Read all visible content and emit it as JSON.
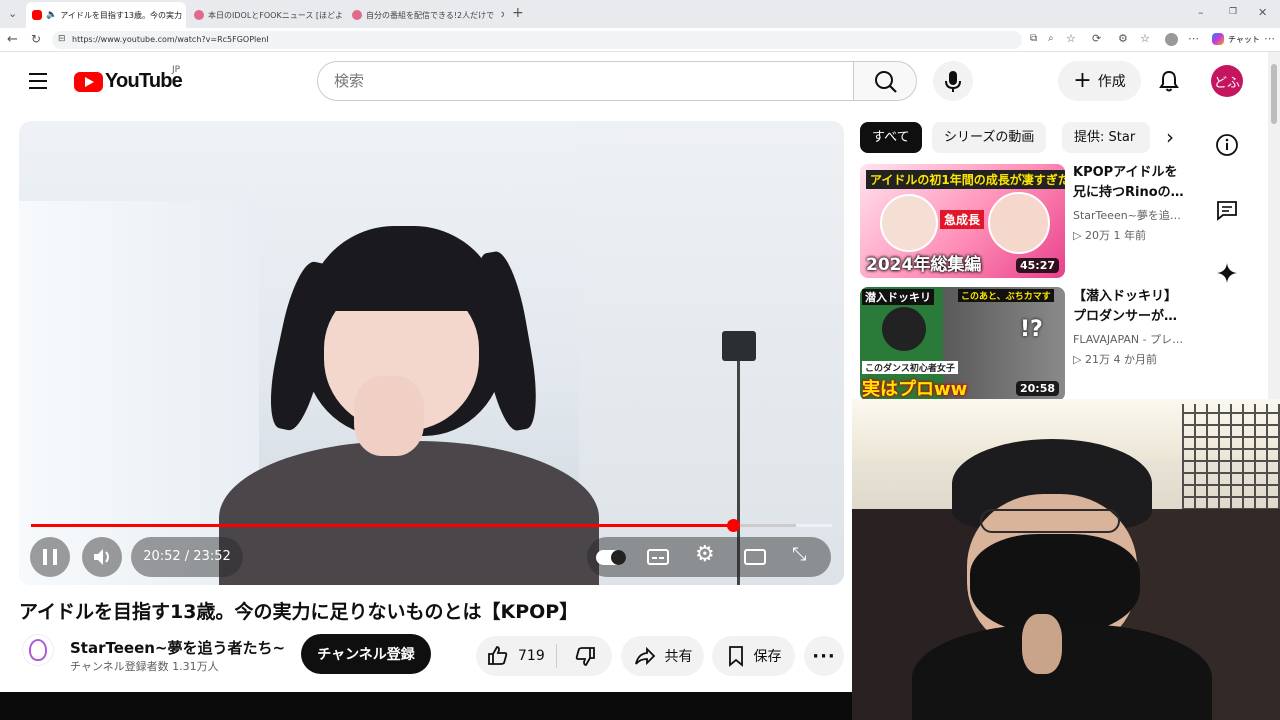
{
  "browser": {
    "tabs": [
      {
        "label": "アイドルを目指す13歳。今の実力",
        "favicon_color": "#ff0000"
      },
      {
        "label": "本日のIDOLとFOOKニュース [ほどよい",
        "favicon_color": "#e06a8a"
      },
      {
        "label": "自分の番組を配信できる!2人だけで",
        "favicon_color": "#e06a8a"
      }
    ],
    "url": "https://www.youtube.com/watch?v=Rc5FGOPlenI",
    "chat_label": "チャット"
  },
  "header": {
    "logo_text": "YouTube",
    "region": "JP",
    "search_placeholder": "検索",
    "create_label": "作成",
    "avatar_text": "どふ"
  },
  "player": {
    "progress": 0.8765,
    "buffered": 0.955,
    "time": "20:52 / 23:52"
  },
  "video": {
    "title": "アイドルを目指す13歳。今の実力に足りないものとは【KPOP】",
    "channel_name": "StarTeeen~夢を追う者たち~",
    "subscribers": "チャンネル登録者数 1.31万人",
    "subscribe_label": "チャンネル登録",
    "likes": "719",
    "share_label": "共有",
    "save_label": "保存"
  },
  "chips": [
    "すべて",
    "シリーズの動画",
    "提供: Star"
  ],
  "related": [
    {
      "title_line1": "KPOPアイドルを",
      "title_line2": "兄に持つRinoの…",
      "channel": "StarTeeen~夢を追…",
      "stats": "20万  1 年前",
      "duration": "45:27",
      "thumb_top": "アイドルの初1年間の成長が凄すぎた",
      "thumb_mid": "急成長",
      "thumb_bottom": "2024年総集編"
    },
    {
      "title_line1": "【潜入ドッキリ】",
      "title_line2": "プロダンサーが…",
      "channel": "FLAVAJAPAN - プレ…",
      "stats": "21万  4 か月前",
      "duration": "20:58",
      "thumb_top": "潜入ドッキリ",
      "thumb_mid": "このあと、ぶちカマす",
      "thumb_sub": "このダンス初心者女子",
      "thumb_bottom": "実はプロww"
    }
  ]
}
